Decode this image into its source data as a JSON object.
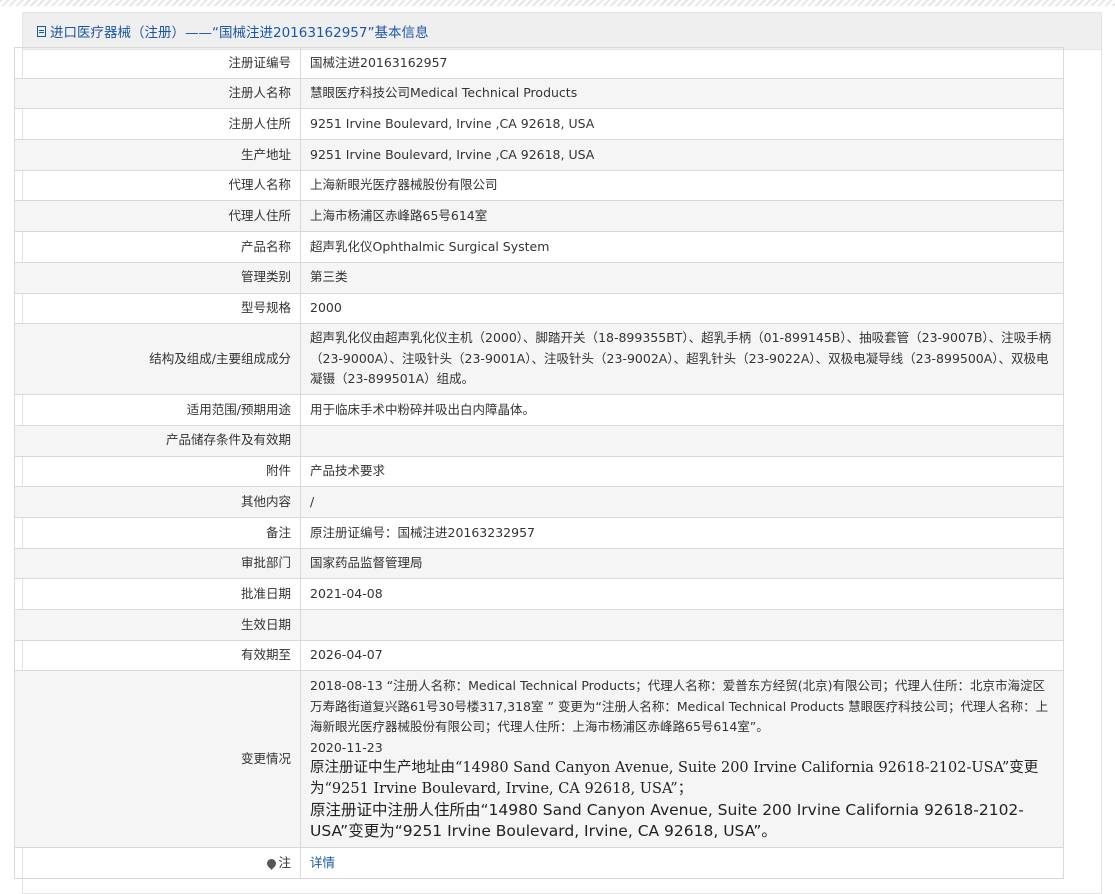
{
  "page": {
    "title": "进口医疗器械（注册）——“国械注进20163162957”基本信息"
  },
  "rows": [
    {
      "label": "注册证编号",
      "value": "国械注进20163162957"
    },
    {
      "label": "注册人名称",
      "value": "慧眼医疗科技公司Medical Technical Products"
    },
    {
      "label": "注册人住所",
      "value": "9251 Irvine Boulevard, Irvine ,CA 92618, USA"
    },
    {
      "label": "生产地址",
      "value": "9251 Irvine Boulevard, Irvine ,CA 92618, USA"
    },
    {
      "label": "代理人名称",
      "value": "上海新眼光医疗器械股份有限公司"
    },
    {
      "label": "代理人住所",
      "value": "上海市杨浦区赤峰路65号614室"
    },
    {
      "label": "产品名称",
      "value": "超声乳化仪Ophthalmic Surgical System"
    },
    {
      "label": "管理类别",
      "value": "第三类"
    },
    {
      "label": "型号规格",
      "value": "2000"
    },
    {
      "label": "结构及组成/主要组成成分",
      "value": "超声乳化仪由超声乳化仪主机（2000）、脚踏开关（18-899355BT）、超乳手柄（01-899145B）、抽吸套管（23-9007B）、注吸手柄（23-9000A）、注吸针头（23-9001A）、注吸针头（23-9002A）、超乳针头（23-9022A）、双极电凝导线（23-899500A）、双极电凝镊（23-899501A）组成。"
    },
    {
      "label": "适用范围/预期用途",
      "value": "用于临床手术中粉碎并吸出白内障晶体。"
    },
    {
      "label": "产品储存条件及有效期",
      "value": ""
    },
    {
      "label": "附件",
      "value": "产品技术要求"
    },
    {
      "label": "其他内容",
      "value": "/"
    },
    {
      "label": "备注",
      "value": "原注册证编号：国械注进20163232957"
    },
    {
      "label": "审批部门",
      "value": "国家药品监督管理局"
    },
    {
      "label": "批准日期",
      "value": "2021-04-08"
    },
    {
      "label": "生效日期",
      "value": ""
    },
    {
      "label": "有效期至",
      "value": "2026-04-07"
    }
  ],
  "changes": {
    "label": "变更情况",
    "entry1": "2018-08-13 “注册人名称：Medical Technical Products；代理人名称：爱普东方经贸(北京)有限公司；代理人住所：北京市海淀区万寿路街道复兴路61号30号楼317,318室 ” 变更为“注册人名称：Medical Technical Products 慧眼医疗科技公司；代理人名称：上海新眼光医疗器械股份有限公司；代理人住所：上海市杨浦区赤峰路65号614室”。",
    "date2": "2020-11-23",
    "entry2a": "原注册证中生产地址由“14980 Sand Canyon Avenue, Suite 200 Irvine California 92618-2102-USA”变更为“9251 Irvine Boulevard, Irvine, CA 92618, USA”；",
    "entry2b": "原注册证中注册人住所由“14980 Sand Canyon Avenue, Suite 200 Irvine California 92618-2102-USA”变更为“9251 Irvine Boulevard, Irvine, CA 92618, USA”。"
  },
  "note": {
    "label": "注",
    "link": "详情"
  }
}
